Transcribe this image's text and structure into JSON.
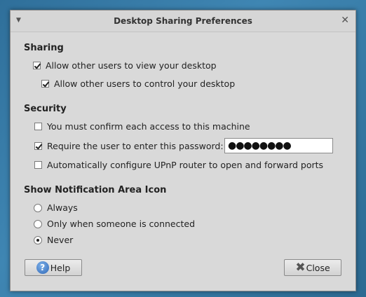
{
  "window": {
    "title": "Desktop Sharing Preferences",
    "menu_icon": "▼",
    "close_icon": "✕"
  },
  "sharing": {
    "heading": "Sharing",
    "allow_view": {
      "label": "Allow other users to view your desktop",
      "checked": true
    },
    "allow_control": {
      "label": "Allow other users to control your desktop",
      "checked": true
    }
  },
  "security": {
    "heading": "Security",
    "confirm_access": {
      "label": "You must confirm each access to this machine",
      "checked": false
    },
    "require_password": {
      "label": "Require the user to enter this password:",
      "checked": true
    },
    "password_value": "●●●●●●●●",
    "upnp": {
      "label": "Automatically configure UPnP router to open and forward ports",
      "checked": false
    }
  },
  "notification": {
    "heading": "Show Notification Area Icon",
    "options": [
      {
        "label": "Always",
        "selected": false
      },
      {
        "label": "Only when someone is connected",
        "selected": false
      },
      {
        "label": "Never",
        "selected": true
      }
    ]
  },
  "buttons": {
    "help_label": "Help",
    "close_label": "Close"
  }
}
